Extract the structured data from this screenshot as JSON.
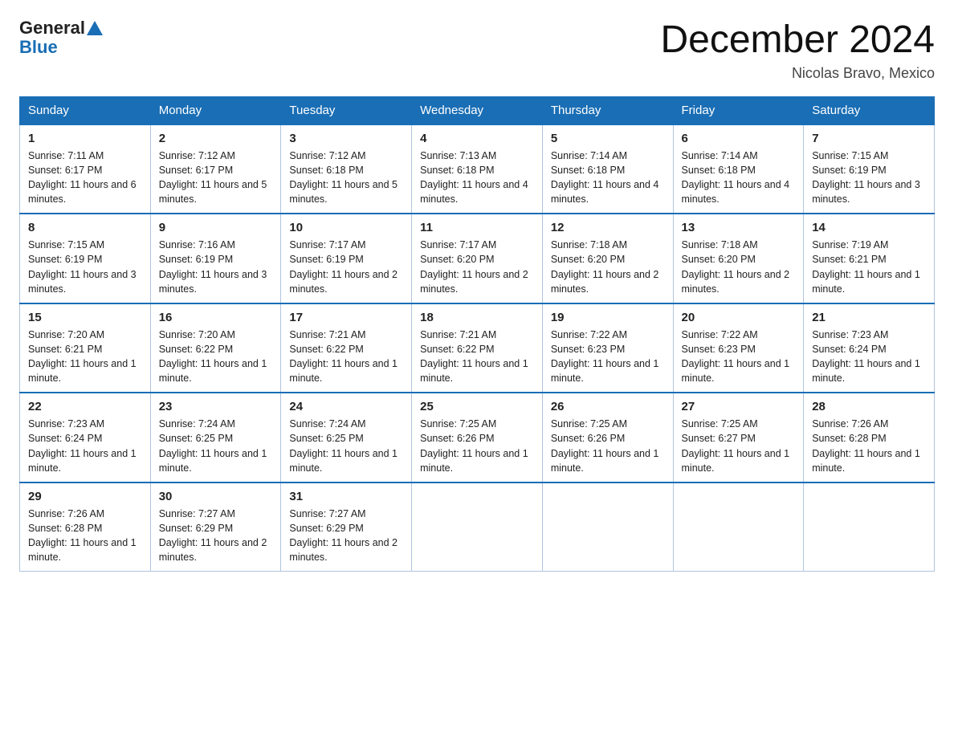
{
  "header": {
    "logo_general": "General",
    "logo_blue": "Blue",
    "month_title": "December 2024",
    "location": "Nicolas Bravo, Mexico"
  },
  "days_of_week": [
    "Sunday",
    "Monday",
    "Tuesday",
    "Wednesday",
    "Thursday",
    "Friday",
    "Saturday"
  ],
  "weeks": [
    [
      {
        "day": "1",
        "sunrise": "7:11 AM",
        "sunset": "6:17 PM",
        "daylight": "11 hours and 6 minutes."
      },
      {
        "day": "2",
        "sunrise": "7:12 AM",
        "sunset": "6:17 PM",
        "daylight": "11 hours and 5 minutes."
      },
      {
        "day": "3",
        "sunrise": "7:12 AM",
        "sunset": "6:18 PM",
        "daylight": "11 hours and 5 minutes."
      },
      {
        "day": "4",
        "sunrise": "7:13 AM",
        "sunset": "6:18 PM",
        "daylight": "11 hours and 4 minutes."
      },
      {
        "day": "5",
        "sunrise": "7:14 AM",
        "sunset": "6:18 PM",
        "daylight": "11 hours and 4 minutes."
      },
      {
        "day": "6",
        "sunrise": "7:14 AM",
        "sunset": "6:18 PM",
        "daylight": "11 hours and 4 minutes."
      },
      {
        "day": "7",
        "sunrise": "7:15 AM",
        "sunset": "6:19 PM",
        "daylight": "11 hours and 3 minutes."
      }
    ],
    [
      {
        "day": "8",
        "sunrise": "7:15 AM",
        "sunset": "6:19 PM",
        "daylight": "11 hours and 3 minutes."
      },
      {
        "day": "9",
        "sunrise": "7:16 AM",
        "sunset": "6:19 PM",
        "daylight": "11 hours and 3 minutes."
      },
      {
        "day": "10",
        "sunrise": "7:17 AM",
        "sunset": "6:19 PM",
        "daylight": "11 hours and 2 minutes."
      },
      {
        "day": "11",
        "sunrise": "7:17 AM",
        "sunset": "6:20 PM",
        "daylight": "11 hours and 2 minutes."
      },
      {
        "day": "12",
        "sunrise": "7:18 AM",
        "sunset": "6:20 PM",
        "daylight": "11 hours and 2 minutes."
      },
      {
        "day": "13",
        "sunrise": "7:18 AM",
        "sunset": "6:20 PM",
        "daylight": "11 hours and 2 minutes."
      },
      {
        "day": "14",
        "sunrise": "7:19 AM",
        "sunset": "6:21 PM",
        "daylight": "11 hours and 1 minute."
      }
    ],
    [
      {
        "day": "15",
        "sunrise": "7:20 AM",
        "sunset": "6:21 PM",
        "daylight": "11 hours and 1 minute."
      },
      {
        "day": "16",
        "sunrise": "7:20 AM",
        "sunset": "6:22 PM",
        "daylight": "11 hours and 1 minute."
      },
      {
        "day": "17",
        "sunrise": "7:21 AM",
        "sunset": "6:22 PM",
        "daylight": "11 hours and 1 minute."
      },
      {
        "day": "18",
        "sunrise": "7:21 AM",
        "sunset": "6:22 PM",
        "daylight": "11 hours and 1 minute."
      },
      {
        "day": "19",
        "sunrise": "7:22 AM",
        "sunset": "6:23 PM",
        "daylight": "11 hours and 1 minute."
      },
      {
        "day": "20",
        "sunrise": "7:22 AM",
        "sunset": "6:23 PM",
        "daylight": "11 hours and 1 minute."
      },
      {
        "day": "21",
        "sunrise": "7:23 AM",
        "sunset": "6:24 PM",
        "daylight": "11 hours and 1 minute."
      }
    ],
    [
      {
        "day": "22",
        "sunrise": "7:23 AM",
        "sunset": "6:24 PM",
        "daylight": "11 hours and 1 minute."
      },
      {
        "day": "23",
        "sunrise": "7:24 AM",
        "sunset": "6:25 PM",
        "daylight": "11 hours and 1 minute."
      },
      {
        "day": "24",
        "sunrise": "7:24 AM",
        "sunset": "6:25 PM",
        "daylight": "11 hours and 1 minute."
      },
      {
        "day": "25",
        "sunrise": "7:25 AM",
        "sunset": "6:26 PM",
        "daylight": "11 hours and 1 minute."
      },
      {
        "day": "26",
        "sunrise": "7:25 AM",
        "sunset": "6:26 PM",
        "daylight": "11 hours and 1 minute."
      },
      {
        "day": "27",
        "sunrise": "7:25 AM",
        "sunset": "6:27 PM",
        "daylight": "11 hours and 1 minute."
      },
      {
        "day": "28",
        "sunrise": "7:26 AM",
        "sunset": "6:28 PM",
        "daylight": "11 hours and 1 minute."
      }
    ],
    [
      {
        "day": "29",
        "sunrise": "7:26 AM",
        "sunset": "6:28 PM",
        "daylight": "11 hours and 1 minute."
      },
      {
        "day": "30",
        "sunrise": "7:27 AM",
        "sunset": "6:29 PM",
        "daylight": "11 hours and 2 minutes."
      },
      {
        "day": "31",
        "sunrise": "7:27 AM",
        "sunset": "6:29 PM",
        "daylight": "11 hours and 2 minutes."
      },
      null,
      null,
      null,
      null
    ]
  ]
}
